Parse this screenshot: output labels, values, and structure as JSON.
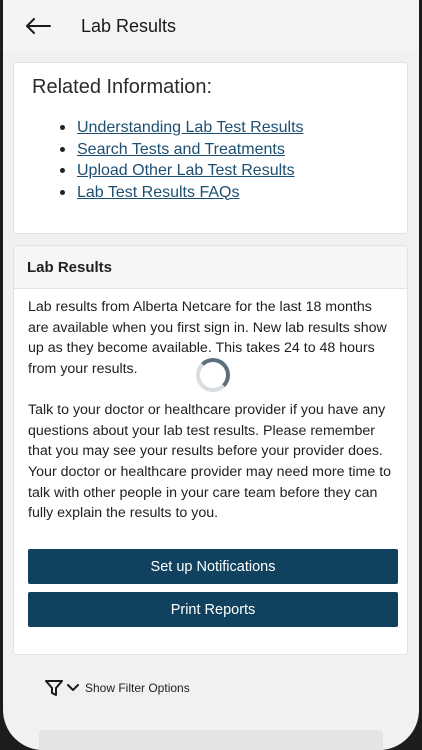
{
  "header": {
    "title": "Lab Results",
    "back_icon": "arrow-left-icon"
  },
  "related": {
    "heading": "Related Information:",
    "links": [
      "Understanding Lab Test Results",
      "Search Tests and Treatments",
      "Upload Other Lab Test Results",
      "Lab Test Results FAQs"
    ]
  },
  "lab": {
    "heading": "Lab Results",
    "paragraph1": "Lab results from Alberta Netcare for the last 18 months are available when you first sign in. New lab results show up as they become available. This takes 24 to 48 hours from your results.",
    "paragraph2": "Talk to your doctor or healthcare provider if you have any questions about your lab test results. Please remember that you may see your results before your provider does. Your doctor or healthcare provider may need more time to talk with other people in your care team before they can fully explain the results to you.",
    "notifications_button": "Set up Notifications",
    "print_button": "Print Reports"
  },
  "filter": {
    "label": "Show Filter Options",
    "filter_icon": "funnel-icon",
    "chevron_icon": "chevron-down-icon"
  },
  "colors": {
    "accent": "#10415f",
    "link": "#1d4f72"
  }
}
